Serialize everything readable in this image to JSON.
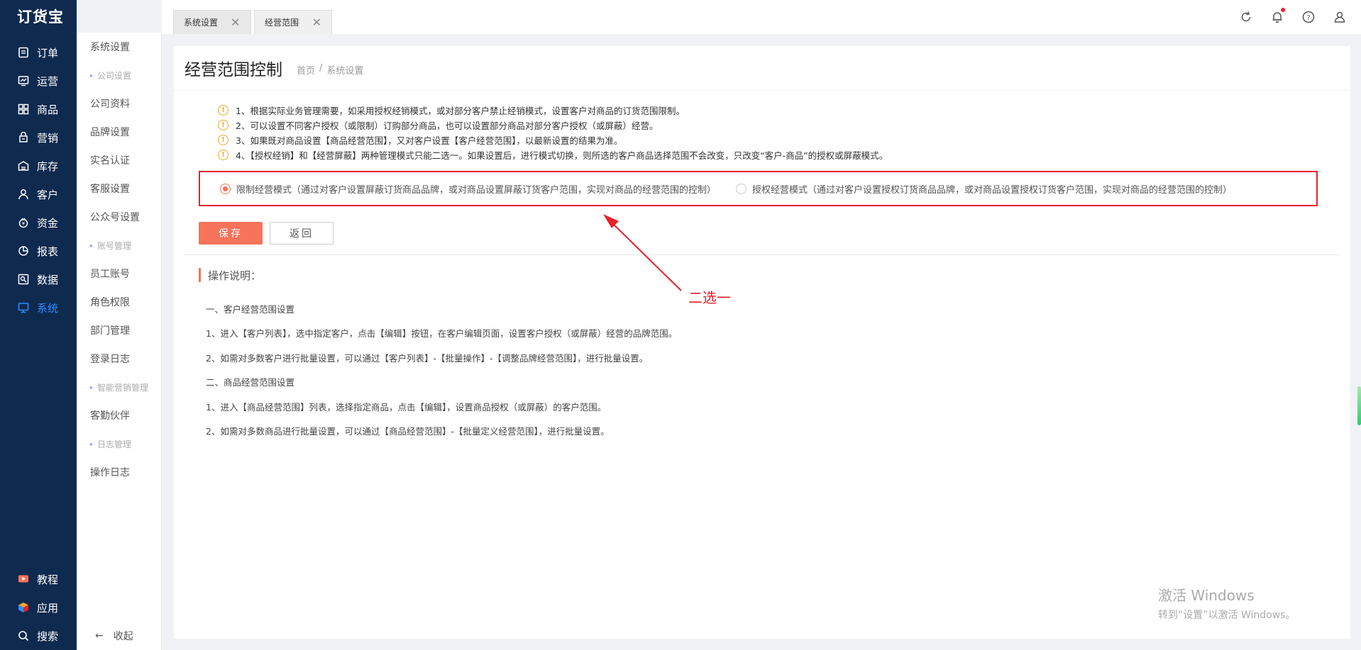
{
  "app": {
    "logo": "订货宝"
  },
  "nav": {
    "items": [
      {
        "label": "订单",
        "icon": "order-icon"
      },
      {
        "label": "运营",
        "icon": "operation-icon"
      },
      {
        "label": "商品",
        "icon": "product-icon"
      },
      {
        "label": "营销",
        "icon": "marketing-icon"
      },
      {
        "label": "库存",
        "icon": "inventory-icon"
      },
      {
        "label": "客户",
        "icon": "customer-icon"
      },
      {
        "label": "资金",
        "icon": "funds-icon"
      },
      {
        "label": "报表",
        "icon": "report-icon"
      },
      {
        "label": "数据",
        "icon": "data-icon"
      },
      {
        "label": "系统",
        "icon": "system-icon",
        "active": true
      }
    ],
    "bottom": [
      {
        "label": "教程",
        "icon": "tutorial-icon"
      },
      {
        "label": "应用",
        "icon": "apps-icon"
      },
      {
        "label": "搜索",
        "icon": "search-icon"
      }
    ]
  },
  "submenu": {
    "top": "系统设置",
    "groups": [
      {
        "title": "公司设置",
        "items": [
          "公司资料",
          "品牌设置",
          "实名认证",
          "客服设置",
          "公众号设置"
        ]
      },
      {
        "title": "账号管理",
        "items": [
          "员工账号",
          "角色权限",
          "部门管理",
          "登录日志"
        ]
      },
      {
        "title": "智能营销管理",
        "items": [
          "客勤伙伴"
        ]
      },
      {
        "title": "日志管理",
        "items": [
          "操作日志"
        ]
      }
    ],
    "collapse": "收起"
  },
  "tabs": [
    {
      "label": "系统设置"
    },
    {
      "label": "经营范围控制"
    }
  ],
  "page": {
    "title": "经营范围控制",
    "breadcrumb": [
      "首页",
      "/",
      "系统设置"
    ]
  },
  "tips": [
    "1、根据实际业务管理需要，如采用授权经销模式，或对部分客户禁止经销模式，设置客户对商品的订货范围限制。",
    "2、可以设置不同客户授权（或限制）订购部分商品，也可以设置部分商品对部分客户授权（或屏蔽）经营。",
    "3、如果既对商品设置【商品经营范围】，又对客户设置【客户经营范围】，以最新设置的结果为准。",
    "4、【授权经销】和【经营屏蔽】两种管理模式只能二选一。如果设置后，进行模式切换，则所选的客户商品选择范围不会改变，只改变“客户-商品”的授权或屏蔽模式。"
  ],
  "modes": {
    "option1": "限制经营模式（通过对客户设置屏蔽订货商品品牌，或对商品设置屏蔽订货客户范围，实现对商品的经营范围的控制）",
    "option2": "授权经营模式（通过对客户设置授权订货商品品牌，或对商品设置授权订货客户范围，实现对商品的经营范围的控制）",
    "selected": "option1"
  },
  "buttons": {
    "save": "保存",
    "back": "返回"
  },
  "help": {
    "title": "操作说明：",
    "lines": [
      "一、客户经营范围设置",
      "1、进入【客户列表】，选中指定客户，点击【编辑】按钮，在客户编辑页面，设置客户授权（或屏蔽）经营的品牌范围。",
      "2、如需对多数客户进行批量设置，可以通过【客户列表】-【批量操作】-【调整品牌经营范围】，进行批量设置。",
      "二、商品经营范围设置",
      "1、进入【商品经营范围】列表，选择指定商品，点击【编辑】，设置商品授权（或屏蔽）的客户范围。",
      "2、如需对多数商品进行批量设置，可以通过【商品经营范围】-【批量定义经营范围】，进行批量设置。"
    ]
  },
  "annotation": {
    "text": "二选一",
    "color": "#e8202a"
  },
  "watermark": {
    "line1": "激活 Windows",
    "line2": "转到“设置”以激活 Windows。"
  },
  "colors": {
    "sidebar": "#0f2a4f",
    "accent": "#f7735a",
    "active_nav": "#2f8cff",
    "annotation": "#e8202a"
  }
}
